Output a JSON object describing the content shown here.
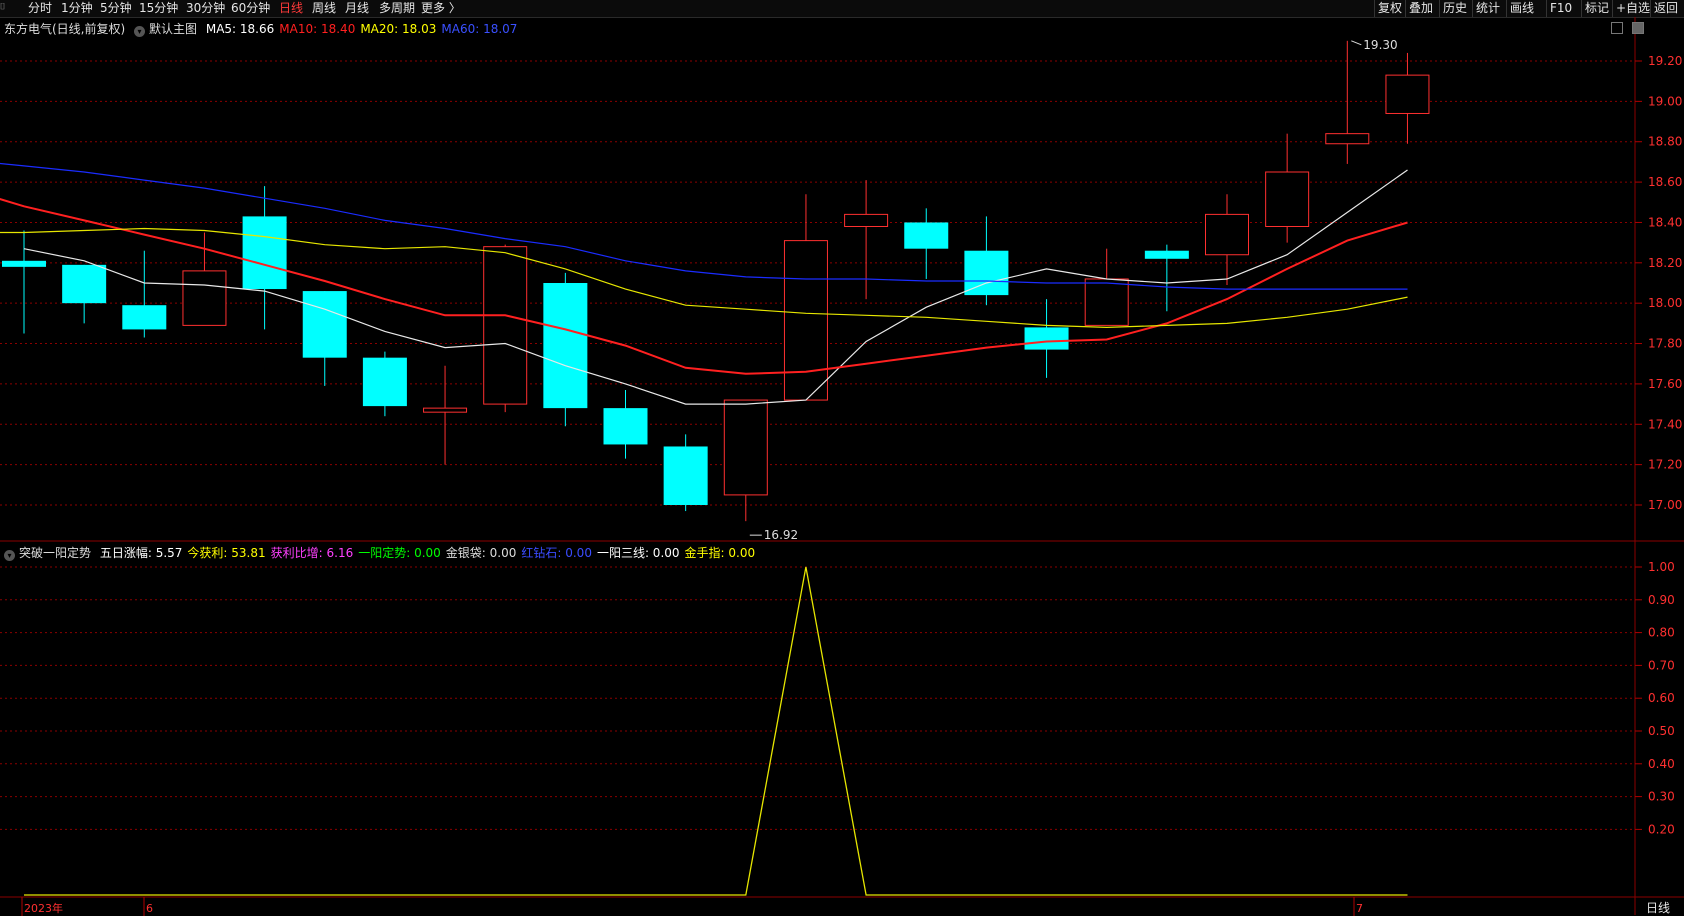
{
  "toolbar": {
    "periods": [
      {
        "label": "分时"
      },
      {
        "label": "1分钟"
      },
      {
        "label": "5分钟"
      },
      {
        "label": "15分钟"
      },
      {
        "label": "30分钟"
      },
      {
        "label": "60分钟"
      },
      {
        "label": "日线",
        "active": true
      },
      {
        "label": "周线"
      },
      {
        "label": "月线"
      },
      {
        "label": "多周期"
      },
      {
        "label": "更多 〉"
      }
    ],
    "right": [
      "复权",
      "叠加",
      "历史",
      "统计",
      "画线",
      "F10",
      "标记",
      "+自选",
      "返回"
    ]
  },
  "main": {
    "title": "东方电气(日线,前复权)",
    "template": "默认主图",
    "ma": [
      {
        "label": "MA5: 18.66",
        "color": "#ffffff"
      },
      {
        "label": "MA10: 18.40",
        "color": "#ff2020"
      },
      {
        "label": "MA20: 18.03",
        "color": "#ffff00"
      },
      {
        "label": "MA60: 18.07",
        "color": "#2a3cff"
      }
    ],
    "high_label": "19.30",
    "low_label": "16.92",
    "axis_ticks": [
      "19.20",
      "19.00",
      "18.80",
      "18.60",
      "18.40",
      "18.20",
      "18.00",
      "17.80",
      "17.60",
      "17.40",
      "17.20",
      "17.00"
    ]
  },
  "sub": {
    "title": "突破一阳定势",
    "items": [
      {
        "label": "五日涨幅: 5.57",
        "color": "#ffffff"
      },
      {
        "label": "今获利: 53.81",
        "color": "#ffff00"
      },
      {
        "label": "获利比增: 6.16",
        "color": "#ff40ff"
      },
      {
        "label": "一阳定势: 0.00",
        "color": "#00ff00"
      },
      {
        "label": "金银袋: 0.00",
        "color": "#dddddd"
      },
      {
        "label": "红钻石: 0.00",
        "color": "#3a4cff"
      },
      {
        "label": "一阳三线: 0.00",
        "color": "#ffffff"
      },
      {
        "label": "金手指: 0.00",
        "color": "#ffff00"
      }
    ],
    "axis_ticks": [
      "1.00",
      "0.90",
      "0.80",
      "0.70",
      "0.60",
      "0.50",
      "0.40",
      "0.30",
      "0.20"
    ]
  },
  "xaxis": {
    "labels": [
      "2023年",
      "6",
      "7"
    ],
    "period_label": "日线"
  },
  "colors": {
    "up": "#ff3030",
    "down": "#00ffff",
    "grid": "#8b0000",
    "bg": "#000000"
  },
  "chart_data": [
    {
      "type": "candlestick",
      "title": "东方电气(日线,前复权)",
      "ylim": [
        16.85,
        19.38
      ],
      "candles": [
        {
          "o": 18.21,
          "h": 18.36,
          "l": 17.85,
          "c": 18.18
        },
        {
          "o": 18.19,
          "h": 18.19,
          "l": 17.9,
          "c": 18.0
        },
        {
          "o": 17.99,
          "h": 18.26,
          "l": 17.83,
          "c": 17.87
        },
        {
          "o": 17.89,
          "h": 18.35,
          "l": 17.89,
          "c": 18.16
        },
        {
          "o": 18.43,
          "h": 18.58,
          "l": 17.87,
          "c": 18.07
        },
        {
          "o": 18.06,
          "h": 18.06,
          "l": 17.59,
          "c": 17.73
        },
        {
          "o": 17.73,
          "h": 17.76,
          "l": 17.44,
          "c": 17.49
        },
        {
          "o": 17.46,
          "h": 17.69,
          "l": 17.2,
          "c": 17.48
        },
        {
          "o": 17.5,
          "h": 18.29,
          "l": 17.46,
          "c": 18.28
        },
        {
          "o": 18.1,
          "h": 18.15,
          "l": 17.39,
          "c": 17.48
        },
        {
          "o": 17.48,
          "h": 17.57,
          "l": 17.23,
          "c": 17.3
        },
        {
          "o": 17.29,
          "h": 17.35,
          "l": 16.97,
          "c": 17.0
        },
        {
          "o": 17.05,
          "h": 17.52,
          "l": 16.92,
          "c": 17.52
        },
        {
          "o": 17.52,
          "h": 18.54,
          "l": 17.52,
          "c": 18.31
        },
        {
          "o": 18.38,
          "h": 18.61,
          "l": 18.02,
          "c": 18.44
        },
        {
          "o": 18.4,
          "h": 18.47,
          "l": 18.12,
          "c": 18.27
        },
        {
          "o": 18.26,
          "h": 18.43,
          "l": 17.99,
          "c": 18.04
        },
        {
          "o": 17.88,
          "h": 18.02,
          "l": 17.63,
          "c": 17.77
        },
        {
          "o": 17.89,
          "h": 18.27,
          "l": 17.89,
          "c": 18.12
        },
        {
          "o": 18.26,
          "h": 18.29,
          "l": 17.96,
          "c": 18.22
        },
        {
          "o": 18.24,
          "h": 18.54,
          "l": 18.09,
          "c": 18.44
        },
        {
          "o": 18.38,
          "h": 18.84,
          "l": 18.3,
          "c": 18.65
        },
        {
          "o": 18.79,
          "h": 19.3,
          "l": 18.69,
          "c": 18.84
        },
        {
          "o": 18.94,
          "h": 19.24,
          "l": 18.79,
          "c": 19.13
        }
      ],
      "series": [
        {
          "name": "MA5",
          "color": "#e8e8e8",
          "values": [
            18.27,
            18.21,
            18.1,
            18.09,
            18.06,
            17.97,
            17.86,
            17.78,
            17.8,
            17.69,
            17.6,
            17.5,
            17.5,
            17.52,
            17.81,
            17.98,
            18.1,
            18.17,
            18.12,
            18.1,
            18.12,
            18.24,
            18.45,
            18.66
          ]
        },
        {
          "name": "MA10",
          "color": "#ff2020",
          "values": [
            18.57,
            18.48,
            18.41,
            18.34,
            18.27,
            18.19,
            18.11,
            18.02,
            17.94,
            17.94,
            17.87,
            17.79,
            17.68,
            17.65,
            17.66,
            17.7,
            17.74,
            17.78,
            17.81,
            17.82,
            17.9,
            18.02,
            18.17,
            18.31,
            18.4
          ]
        },
        {
          "name": "MA20",
          "color": "#e6e600",
          "values": [
            18.32,
            18.35,
            18.35,
            18.36,
            18.37,
            18.36,
            18.33,
            18.29,
            18.27,
            18.28,
            18.25,
            18.17,
            18.07,
            17.99,
            17.97,
            17.95,
            17.94,
            17.93,
            17.91,
            17.89,
            17.88,
            17.89,
            17.9,
            17.93,
            17.97,
            18.03
          ]
        },
        {
          "name": "MA60",
          "color": "#1a2cff",
          "values": [
            18.74,
            18.71,
            18.68,
            18.65,
            18.61,
            18.57,
            18.52,
            18.47,
            18.41,
            18.37,
            18.32,
            18.28,
            18.21,
            18.16,
            18.13,
            18.12,
            18.12,
            18.11,
            18.11,
            18.1,
            18.1,
            18.08,
            18.07,
            18.07,
            18.07,
            18.07
          ]
        }
      ]
    },
    {
      "type": "line",
      "title": "突破一阳定势",
      "ylim": [
        0,
        1.04
      ],
      "series": [
        {
          "color": "#e6e600",
          "values": [
            0,
            0,
            0,
            0,
            0,
            0,
            0,
            0,
            0,
            0,
            0,
            0,
            0,
            1,
            0,
            0,
            0,
            0,
            0,
            0,
            0,
            0,
            0,
            0
          ]
        }
      ]
    }
  ]
}
